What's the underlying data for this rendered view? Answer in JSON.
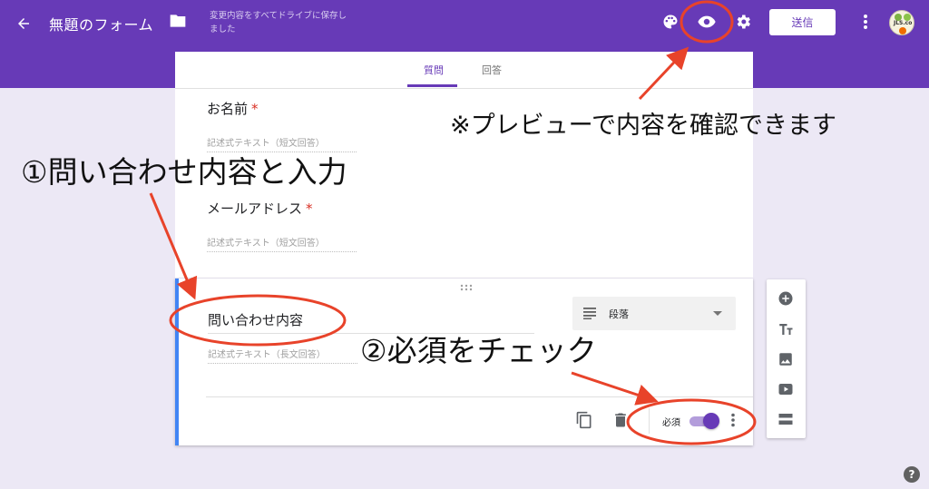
{
  "header": {
    "form_title": "無題のフォーム",
    "save_status": "変更内容をすべてドライブに保存しました",
    "send_label": "送信",
    "avatar_text": "JLS.co"
  },
  "tabs": [
    {
      "label": "質問",
      "active": true
    },
    {
      "label": "回答",
      "active": false
    }
  ],
  "questions": [
    {
      "title": "お名前",
      "required_mark": "*",
      "placeholder": "記述式テキスト（短文回答）"
    },
    {
      "title": "メールアドレス",
      "required_mark": "*",
      "placeholder": "記述式テキスト（短文回答）"
    }
  ],
  "active_question": {
    "title": "問い合わせ内容",
    "type_label": "段落",
    "placeholder": "記述式テキスト（長文回答）",
    "required_label": "必須",
    "required_on": true
  },
  "annotations": {
    "preview_note": "※プレビューで内容を確認できます",
    "step1": "①問い合わせ内容と入力",
    "step2": "②必須をチェック"
  },
  "help_label": "?",
  "colors": {
    "primary": "#673ab7",
    "background": "#ece8f5",
    "annotation_red": "#e8432a",
    "active_card_border": "#4285f4",
    "required_star": "#d93025"
  },
  "icons": {
    "header": [
      "back-arrow-icon",
      "folder-icon",
      "palette-icon",
      "eye-icon",
      "gear-icon",
      "more-vert-icon"
    ],
    "side_toolbar": [
      "add-circle-icon",
      "title-text-icon",
      "image-icon",
      "video-icon",
      "section-icon"
    ],
    "card_footer": [
      "copy-icon",
      "trash-icon",
      "more-vert-icon"
    ]
  }
}
